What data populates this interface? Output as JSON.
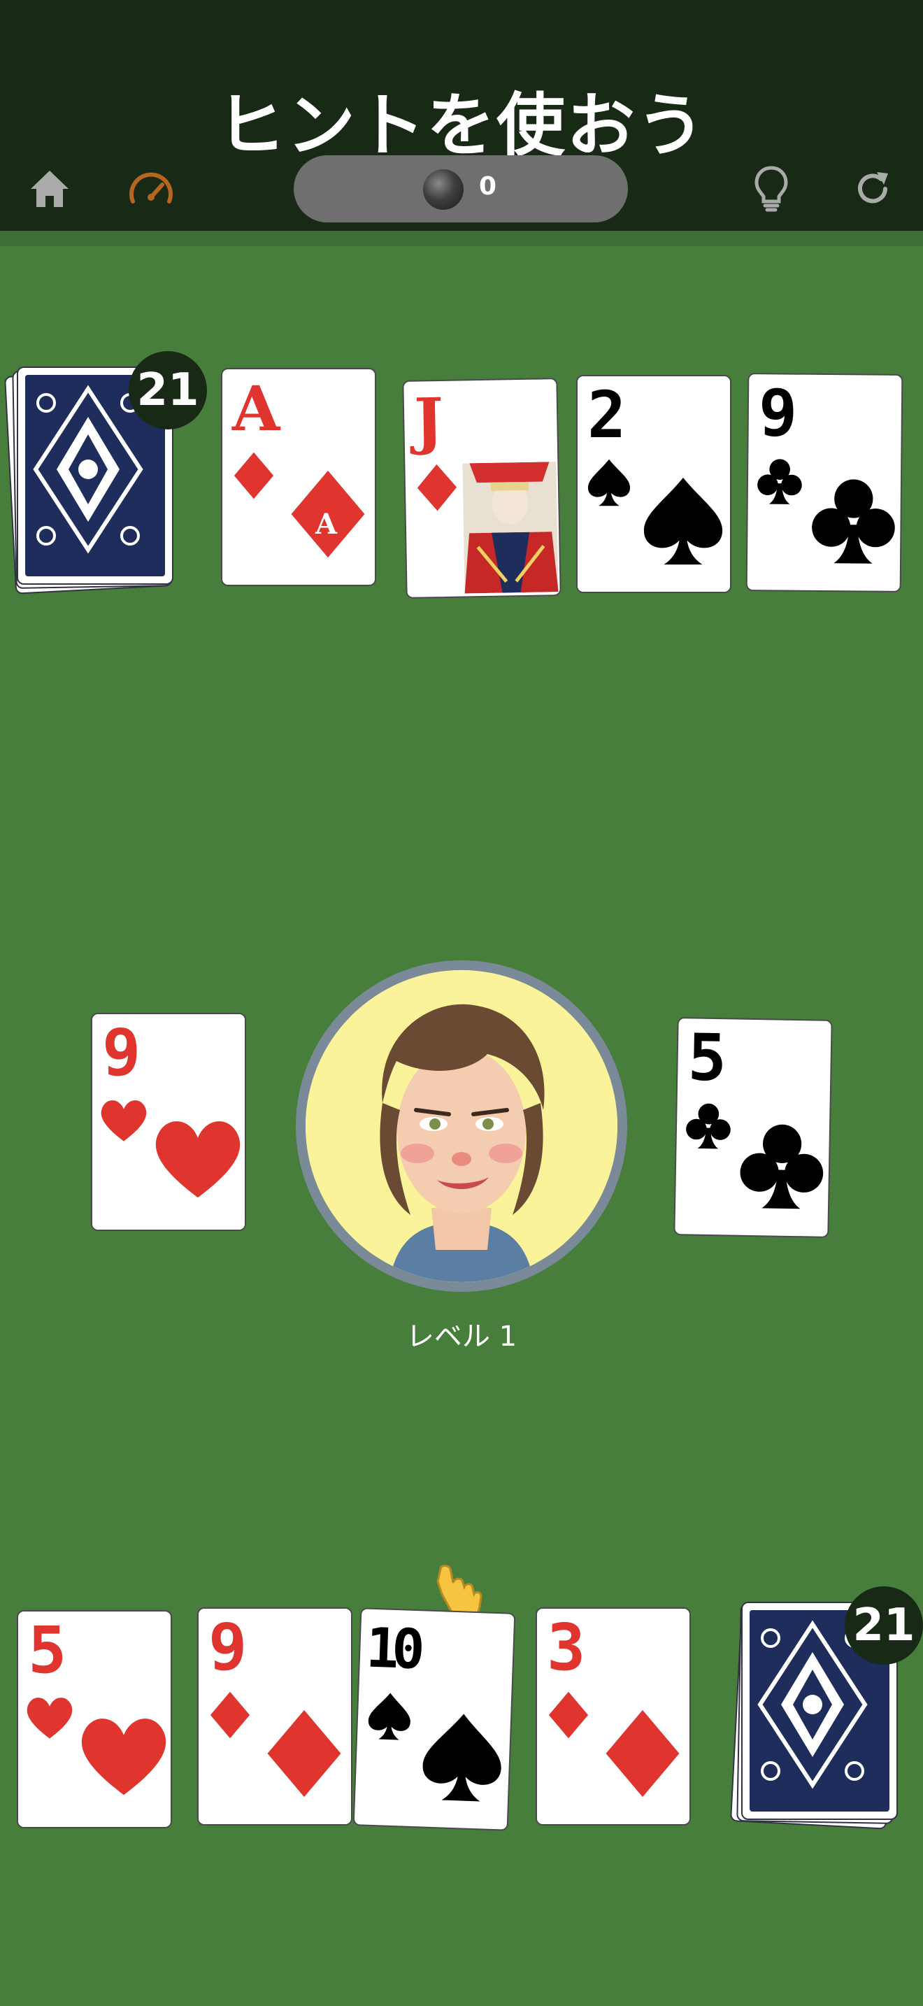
{
  "header": {
    "title": "ヒントを使おう",
    "coins": "0",
    "icons": [
      "home-icon",
      "speedometer-icon",
      "coin-icon",
      "lightbulb-icon",
      "restart-icon"
    ]
  },
  "colors": {
    "felt": "#477e3c",
    "header_bg": "#182916",
    "red_suit": "#e0352f",
    "black_suit": "#000000",
    "card_back": "#1f2d5c",
    "speedometer": "#b5651d"
  },
  "opponent": {
    "deck_count": "21",
    "cards": [
      {
        "rank": "A",
        "suit": "diamonds",
        "color": "red"
      },
      {
        "rank": "J",
        "suit": "diamonds",
        "color": "red",
        "face": true
      },
      {
        "rank": "2",
        "suit": "spades",
        "color": "black"
      },
      {
        "rank": "9",
        "suit": "clubs",
        "color": "black"
      }
    ]
  },
  "table": {
    "left_card": {
      "rank": "9",
      "suit": "hearts",
      "color": "red"
    },
    "right_card": {
      "rank": "5",
      "suit": "clubs",
      "color": "black"
    },
    "level_label": "レベル 1"
  },
  "player": {
    "deck_count": "21",
    "hint_index": 2,
    "cards": [
      {
        "rank": "5",
        "suit": "hearts",
        "color": "red"
      },
      {
        "rank": "9",
        "suit": "diamonds",
        "color": "red"
      },
      {
        "rank": "10",
        "suit": "spades",
        "color": "black"
      },
      {
        "rank": "3",
        "suit": "diamonds",
        "color": "red"
      }
    ]
  }
}
